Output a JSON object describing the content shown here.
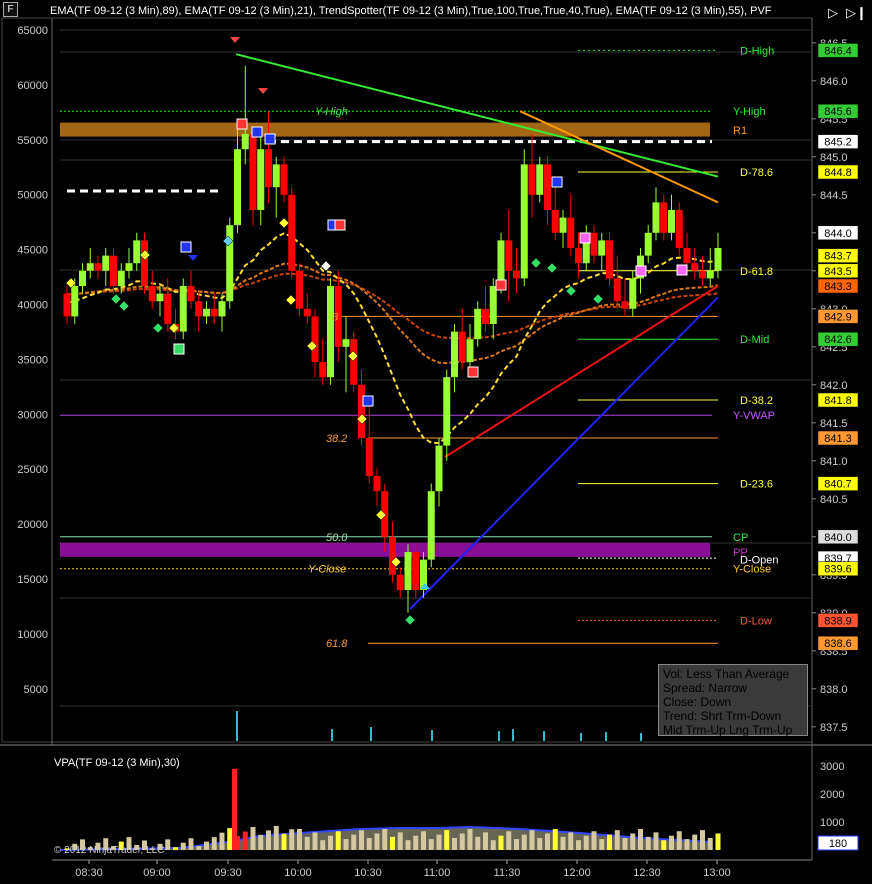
{
  "header": {
    "indicators_title": "EMA(TF 09-12 (3 Min),89), EMA(TF 09-12 (3 Min),21), TrendSpotter(TF 09-12 (3 Min),True,100,True,True,40,True), EMA(TF 09-12 (3 Min),55), PVF",
    "corner_label": "F",
    "vpa_title": "VPA(TF 09-12 (3 Min),30)"
  },
  "info_box": {
    "lines": [
      "Vol: Less Than Average",
      "Spread: Narrow",
      "Close: Down",
      "Trend:  Shrt Trm-Down",
      "Mid Trm-Up  Lng Trm-Up"
    ]
  },
  "copyright": "© 2012 NinjaTrader, LLC",
  "colors": {
    "background": "#000000",
    "up_candle": "#99ff33",
    "down_candle": "#ff0000",
    "volume_bar": "#d4c8a0",
    "high_volume": "#ffff33",
    "r1_band": "#c07818",
    "pp_band": "#a010b0",
    "trend_green": "#33ee33",
    "trend_orange": "#ff9900",
    "trend_red": "#ee1111",
    "trend_blue": "#2222ff"
  },
  "chart_data": {
    "type": "candlestick",
    "x_ticks": [
      "08:30",
      "09:00",
      "09:30",
      "10:00",
      "10:30",
      "11:00",
      "11:30",
      "12:00",
      "12:30",
      "13:00"
    ],
    "left_axis_ticks": [
      65000,
      60000,
      55000,
      50000,
      45000,
      40000,
      35000,
      30000,
      25000,
      20000,
      15000,
      10000,
      5000
    ],
    "right_axis_ticks": [
      846.5,
      846.0,
      845.5,
      845.0,
      844.5,
      844.0,
      843.5,
      843.0,
      842.5,
      842.0,
      841.5,
      841.0,
      840.5,
      840.0,
      839.5,
      839.0,
      838.5,
      838.0,
      837.5
    ],
    "price_axis": {
      "min": 837.3,
      "max": 846.8
    },
    "volume_axis_ticks": [
      3000,
      2000,
      1000
    ],
    "price_badges": [
      {
        "value": "846.4",
        "price": 846.4,
        "color": "#33cc33"
      },
      {
        "value": "845.6",
        "price": 845.6,
        "color": "#33cc33"
      },
      {
        "value": "845.2",
        "price": 845.2,
        "color": "#ffffff"
      },
      {
        "value": "844.8",
        "price": 844.8,
        "color": "#ffff00"
      },
      {
        "value": "844.0",
        "price": 844.0,
        "color": "#ffffff"
      },
      {
        "value": "843.7",
        "price": 843.7,
        "color": "#ffff00"
      },
      {
        "value": "843.5",
        "price": 843.5,
        "color": "#ffff00"
      },
      {
        "value": "843.3",
        "price": 843.3,
        "color": "#ff6600"
      },
      {
        "value": "842.9",
        "price": 842.9,
        "color": "#ff9933"
      },
      {
        "value": "842.6",
        "price": 842.6,
        "color": "#33cc33"
      },
      {
        "value": "841.8",
        "price": 841.8,
        "color": "#ffff00"
      },
      {
        "value": "841.3",
        "price": 841.3,
        "color": "#ff9933"
      },
      {
        "value": "840.7",
        "price": 840.7,
        "color": "#ffff00"
      },
      {
        "value": "840.0",
        "price": 840.0,
        "color": "#dddddd"
      },
      {
        "value": "839.7",
        "price": 839.72,
        "color": "#ffffff"
      },
      {
        "value": "839.6",
        "price": 839.58,
        "color": "#ffff00"
      },
      {
        "value": "838.9",
        "price": 838.9,
        "color": "#ff5533"
      },
      {
        "value": "838.6",
        "price": 838.6,
        "color": "#ff9933"
      }
    ],
    "level_labels": [
      {
        "text": "D-High",
        "price": 846.4,
        "color": "#33ee33"
      },
      {
        "text": "Y-High",
        "price": 845.6,
        "color": "#33ee33"
      },
      {
        "text": "R1",
        "price": 845.35,
        "color": "#ff9933"
      },
      {
        "text": "D-78.6",
        "price": 844.8,
        "color": "#ffff33"
      },
      {
        "text": "D-61.8",
        "price": 843.5,
        "color": "#ffff33"
      },
      {
        "text": "D-Mid",
        "price": 842.6,
        "color": "#33ee33"
      },
      {
        "text": "D-38.2",
        "price": 841.8,
        "color": "#ffff33"
      },
      {
        "text": "Y-VWAP",
        "price": 841.6,
        "color": "#cc55ff"
      },
      {
        "text": "D-23.6",
        "price": 840.7,
        "color": "#ffff33"
      },
      {
        "text": "CP",
        "price": 840.0,
        "color": "#33ee33"
      },
      {
        "text": "PP",
        "price": 839.8,
        "color": "#cc22cc"
      },
      {
        "text": "D-Open",
        "price": 839.7,
        "color": "#ffffff"
      },
      {
        "text": "Y-Close",
        "price": 839.58,
        "color": "#ffcc33"
      },
      {
        "text": "D-Low",
        "price": 838.9,
        "color": "#ff5533"
      }
    ],
    "fib_labels": [
      {
        "text": "Y-High",
        "price": 845.6,
        "color": "#33ee33"
      },
      {
        "text": "38.2",
        "price": 841.3,
        "color": "#ff9933"
      },
      {
        "text": "50.0",
        "price": 840.0,
        "color": "#aaddaa"
      },
      {
        "text": "Y-Close",
        "price": 839.58,
        "color": "#ffcc33"
      },
      {
        "text": "61.8",
        "price": 838.6,
        "color": "#ff9933"
      },
      {
        "text": "3",
        "price": 842.9,
        "color": "#ff9933"
      }
    ],
    "candles": [
      [
        843.2,
        843.3,
        842.8,
        842.9
      ],
      [
        842.9,
        843.4,
        842.8,
        843.3
      ],
      [
        843.3,
        843.6,
        843.2,
        843.5
      ],
      [
        843.5,
        843.8,
        843.4,
        843.6
      ],
      [
        843.6,
        843.7,
        843.4,
        843.5
      ],
      [
        843.5,
        843.8,
        843.3,
        843.7
      ],
      [
        843.7,
        843.8,
        843.2,
        843.3
      ],
      [
        843.3,
        843.6,
        843.2,
        843.5
      ],
      [
        843.5,
        843.8,
        843.4,
        843.6
      ],
      [
        843.6,
        844.0,
        843.5,
        843.9
      ],
      [
        843.9,
        844.0,
        843.2,
        843.3
      ],
      [
        843.3,
        843.5,
        843.0,
        843.1
      ],
      [
        843.1,
        843.3,
        842.9,
        843.2
      ],
      [
        843.2,
        843.4,
        842.7,
        842.8
      ],
      [
        842.8,
        843.0,
        842.6,
        842.7
      ],
      [
        842.7,
        843.4,
        842.6,
        843.3
      ],
      [
        843.3,
        843.5,
        843.0,
        843.1
      ],
      [
        843.1,
        843.2,
        842.7,
        842.9
      ],
      [
        842.9,
        843.1,
        842.8,
        843.0
      ],
      [
        843.0,
        843.2,
        842.8,
        842.9
      ],
      [
        842.9,
        843.2,
        842.7,
        843.1
      ],
      [
        843.1,
        844.2,
        843.0,
        844.1
      ],
      [
        844.1,
        845.4,
        844.0,
        845.1
      ],
      [
        845.1,
        846.2,
        844.9,
        845.3
      ],
      [
        845.3,
        845.4,
        844.1,
        844.3
      ],
      [
        844.3,
        845.4,
        844.1,
        845.1
      ],
      [
        845.1,
        845.6,
        844.4,
        844.6
      ],
      [
        844.6,
        845.0,
        844.2,
        844.9
      ],
      [
        844.9,
        845.0,
        844.4,
        844.5
      ],
      [
        844.5,
        844.6,
        843.4,
        843.5
      ],
      [
        843.5,
        843.6,
        842.9,
        843.0
      ],
      [
        843.0,
        843.2,
        842.8,
        842.9
      ],
      [
        842.9,
        843.0,
        842.1,
        842.3
      ],
      [
        842.3,
        842.6,
        842.0,
        842.1
      ],
      [
        842.1,
        843.4,
        842.0,
        843.3
      ],
      [
        843.3,
        843.5,
        842.3,
        842.5
      ],
      [
        842.5,
        842.9,
        841.9,
        842.6
      ],
      [
        842.6,
        842.7,
        841.9,
        842.0
      ],
      [
        842.0,
        842.2,
        841.2,
        841.3
      ],
      [
        841.3,
        841.8,
        840.7,
        840.8
      ],
      [
        840.8,
        840.9,
        840.4,
        840.6
      ],
      [
        840.6,
        840.7,
        839.8,
        840.0
      ],
      [
        840.0,
        840.2,
        839.4,
        839.5
      ],
      [
        839.5,
        839.6,
        839.2,
        839.3
      ],
      [
        839.3,
        839.9,
        839.0,
        839.8
      ],
      [
        839.8,
        839.9,
        839.2,
        839.3
      ],
      [
        839.3,
        839.8,
        839.2,
        839.7
      ],
      [
        839.7,
        840.7,
        839.6,
        840.6
      ],
      [
        840.6,
        841.3,
        840.4,
        841.2
      ],
      [
        841.2,
        842.2,
        841.0,
        842.1
      ],
      [
        842.1,
        842.8,
        841.9,
        842.7
      ],
      [
        842.7,
        843.0,
        842.2,
        842.3
      ],
      [
        842.3,
        842.8,
        842.1,
        842.6
      ],
      [
        842.6,
        843.1,
        842.5,
        843.0
      ],
      [
        843.0,
        843.3,
        842.7,
        842.8
      ],
      [
        842.8,
        843.4,
        842.6,
        843.3
      ],
      [
        843.3,
        844.0,
        843.2,
        843.9
      ],
      [
        843.9,
        844.3,
        843.1,
        843.5
      ],
      [
        843.5,
        843.8,
        843.2,
        843.4
      ],
      [
        843.4,
        845.1,
        843.3,
        844.9
      ],
      [
        844.9,
        845.3,
        844.2,
        844.5
      ],
      [
        844.5,
        845.0,
        844.4,
        844.9
      ],
      [
        844.9,
        845.0,
        844.1,
        844.3
      ],
      [
        844.3,
        844.7,
        843.9,
        844.0
      ],
      [
        844.0,
        844.3,
        843.8,
        844.2
      ],
      [
        844.2,
        844.5,
        843.7,
        843.8
      ],
      [
        843.8,
        844.0,
        843.4,
        843.6
      ],
      [
        843.6,
        844.1,
        843.5,
        844.0
      ],
      [
        844.0,
        844.1,
        843.6,
        843.7
      ],
      [
        843.7,
        844.0,
        843.5,
        843.9
      ],
      [
        843.9,
        844.0,
        843.3,
        843.4
      ],
      [
        843.4,
        843.7,
        843.0,
        843.1
      ],
      [
        843.1,
        843.4,
        842.9,
        843.0
      ],
      [
        843.0,
        843.5,
        842.9,
        843.4
      ],
      [
        843.4,
        843.8,
        843.2,
        843.7
      ],
      [
        843.7,
        844.1,
        843.6,
        844.0
      ],
      [
        844.0,
        844.6,
        843.9,
        844.4
      ],
      [
        844.4,
        844.5,
        843.9,
        844.0
      ],
      [
        844.0,
        844.5,
        843.9,
        844.3
      ],
      [
        844.3,
        844.4,
        843.7,
        843.8
      ],
      [
        843.8,
        844.0,
        843.5,
        843.6
      ],
      [
        843.6,
        843.8,
        843.4,
        843.5
      ],
      [
        843.5,
        843.7,
        843.3,
        843.4
      ],
      [
        843.4,
        843.8,
        843.3,
        843.5
      ],
      [
        843.5,
        844.0,
        843.4,
        843.8
      ]
    ]
  }
}
